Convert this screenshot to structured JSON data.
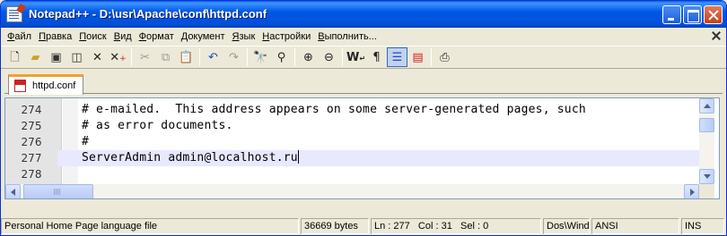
{
  "window": {
    "title": "Notepad++ - D:\\usr\\Apache\\conf\\httpd.conf"
  },
  "menu": {
    "items": [
      "Файл",
      "Правка",
      "Поиск",
      "Вид",
      "Формат",
      "Документ",
      "Язык",
      "Настройки",
      "Выполнить..."
    ]
  },
  "toolbar": {
    "icons": [
      "new-file-icon",
      "open-file-icon",
      "save-icon",
      "save-all-icon",
      "close-icon",
      "close-all-icon",
      "cut-icon",
      "copy-icon",
      "paste-icon",
      "undo-icon",
      "redo-icon",
      "find-icon",
      "replace-icon",
      "zoom-in-icon",
      "zoom-out-icon",
      "word-wrap-icon",
      "show-all-chars-icon",
      "indent-guide-icon",
      "user-lang-icon",
      "print-icon"
    ]
  },
  "tabs": [
    {
      "label": "httpd.conf",
      "active": true
    }
  ],
  "editor": {
    "lines": [
      {
        "number": "274",
        "text": "# e-mailed.  This address appears on some server-generated pages, such"
      },
      {
        "number": "275",
        "text": "# as error documents."
      },
      {
        "number": "276",
        "text": "#"
      },
      {
        "number": "277",
        "text": "ServerAdmin admin@localhost.ru",
        "current": true
      },
      {
        "number": "278",
        "text": ""
      }
    ]
  },
  "status": {
    "file_type": "Personal Home Page language file",
    "length": "36669 bytes",
    "position": "Ln : 277   Col : 31   Sel : 0",
    "eol": "Dos\\Windows",
    "encoding": "ANSI",
    "mode": "INS"
  },
  "colors": {
    "title_bar": "#0058e6",
    "current_line": "#e8e8ff",
    "tab_accent": "#f3a031"
  }
}
